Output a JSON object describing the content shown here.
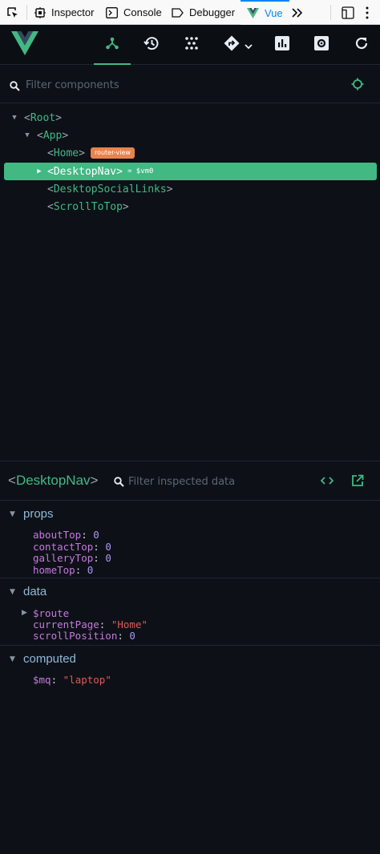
{
  "firefox_toolbar": {
    "tabs": [
      {
        "label": "Inspector",
        "icon": "inspector-icon"
      },
      {
        "label": "Console",
        "icon": "console-icon"
      },
      {
        "label": "Debugger",
        "icon": "debugger-icon"
      },
      {
        "label": "Vue",
        "icon": "vue-icon",
        "active": true
      }
    ],
    "overflow_icon": "chevrons-right-icon",
    "dock_icon": "dock-side-icon",
    "more_icon": "kebab-menu-icon"
  },
  "vue_header": {
    "logo": "vue-logo",
    "nav_icons": [
      "components-icon",
      "timeline-icon",
      "vuex-icon",
      "router-icon",
      "performance-icon",
      "settings-icon",
      "refresh-icon"
    ],
    "active_nav": "components-icon"
  },
  "component_filter": {
    "placeholder": "Filter components"
  },
  "tree": {
    "root": "Root",
    "app": "App",
    "home": "Home",
    "home_badge": "router-view",
    "desktop_nav": "DesktopNav",
    "vm_label": "= $vm0",
    "social_links": "DesktopSocialLinks",
    "scroll_top": "ScrollToTop"
  },
  "inspector": {
    "component": "DesktopNav",
    "filter_placeholder": "Filter inspected data",
    "sections": {
      "props": {
        "title": "props",
        "items": [
          {
            "key": "aboutTop",
            "value": "0"
          },
          {
            "key": "contactTop",
            "value": "0"
          },
          {
            "key": "galleryTop",
            "value": "0"
          },
          {
            "key": "homeTop",
            "value": "0"
          }
        ]
      },
      "data": {
        "title": "data",
        "route_key": "$route",
        "items": [
          {
            "key": "currentPage",
            "value": "\"Home\""
          },
          {
            "key": "scrollPosition",
            "value": "0"
          }
        ]
      },
      "computed": {
        "title": "computed",
        "items": [
          {
            "key": "$mq",
            "value": "\"laptop\""
          }
        ]
      }
    }
  },
  "colors": {
    "accent": "#42b883",
    "background": "#0d1117",
    "badge": "#e8834d",
    "string": "#e2575a",
    "key": "#c678dd"
  }
}
